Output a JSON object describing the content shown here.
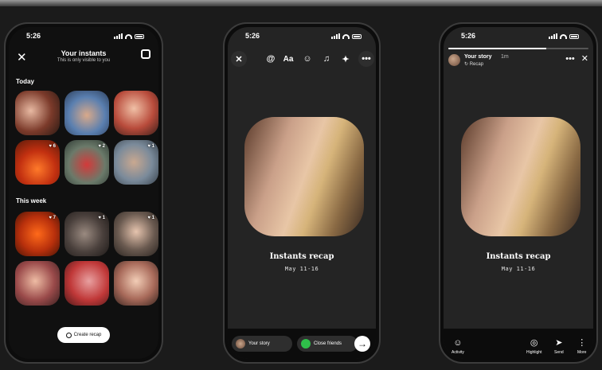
{
  "statusbar": {
    "time": "5:26"
  },
  "instants": {
    "title": "Your instants",
    "subtitle": "This is only visible to you",
    "today_label": "Today",
    "week_label": "This week",
    "today_tiles": [
      {
        "badge": ""
      },
      {
        "badge": ""
      },
      {
        "badge": ""
      },
      {
        "badge": "♥ 6"
      },
      {
        "badge": "♥ 2"
      },
      {
        "badge": "♥ 1"
      }
    ],
    "week_tiles": [
      {
        "badge": "♥ 7"
      },
      {
        "badge": "♥ 1"
      },
      {
        "badge": "♥ 1"
      },
      {
        "badge": ""
      },
      {
        "badge": ""
      },
      {
        "badge": ""
      }
    ],
    "create_label": "Create recap"
  },
  "editor": {
    "tools": [
      "@",
      "Aa"
    ],
    "recap_title": "Instants recap",
    "recap_date": "May 11-16",
    "your_story_label": "Your story",
    "close_friends_label": "Close friends"
  },
  "story": {
    "user_name": "Your story",
    "time_ago": "1m",
    "subtitle": "Recap",
    "recap_title": "Instants recap",
    "recap_date": "May 11-16",
    "progress": 0.7,
    "actions": [
      {
        "label": "Activity"
      },
      {
        "label": "Highlight"
      },
      {
        "label": "Send"
      },
      {
        "label": "More"
      }
    ]
  }
}
